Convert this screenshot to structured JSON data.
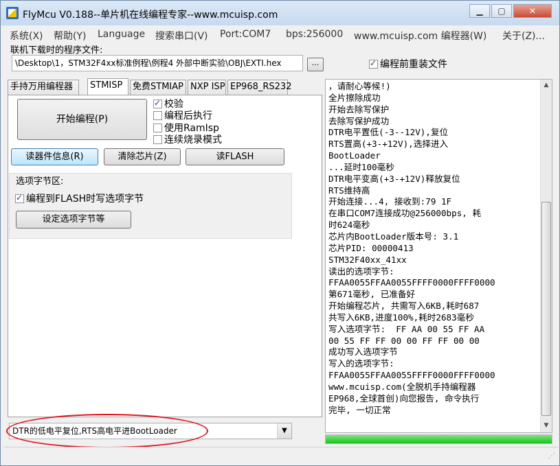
{
  "titlebar": {
    "title": "FlyMcu V0.188--单片机在线编程专家--www.mcuisp.com"
  },
  "menubar": {
    "items": [
      "系统(X)",
      "帮助(Y)",
      "Language",
      "搜索串口(V)",
      "Port:COM7",
      "bps:256000",
      "www.mcuisp.com 编程器(W)",
      "关于(Z)..."
    ]
  },
  "file": {
    "label": "联机下载时的程序文件:",
    "path": "\\Desktop\\1，STM32F4xx标准例程\\例程4 外部中断实验\\OBJ\\EXTI.hex",
    "browse_label": "...",
    "reload_label": "编程前重装文件",
    "reload_checked": true
  },
  "tabs": [
    "手持万用编程器",
    "STMISP",
    "免费STMIAP",
    "NXP ISP",
    "EP968_RS232"
  ],
  "active_tab": "STMISP",
  "stmisp": {
    "start_label": "开始编程(P)",
    "options": [
      {
        "label": "校验",
        "checked": true
      },
      {
        "label": "编程后执行",
        "checked": false
      },
      {
        "label": "使用RamIsp",
        "checked": false
      },
      {
        "label": "连续烧录模式",
        "checked": false
      }
    ],
    "read_info_label": "读器件信息(R)",
    "erase_label": "清除芯片(Z)",
    "read_flash_label": "读FLASH",
    "option_group_title": "选项字节区:",
    "write_option_label": "编程到FLASH时写选项字节",
    "write_option_checked": true,
    "set_option_label": "设定选项字节等"
  },
  "reset_mode": "DTR的低电平复位,RTS高电平进BootLoader",
  "log_lines": [
    "，请耐心等候!)",
    "全片擦除成功",
    "开始去除写保护",
    "去除写保护成功",
    "DTR电平置低(-3--12V),复位",
    "RTS置高(+3-+12V),选择进入",
    "BootLoader",
    "...延时100毫秒",
    "DTR电平变高(+3-+12V)释放复位",
    "RTS维持高",
    "开始连接...4, 接收到:79 1F",
    "在串口COM7连接成功@256000bps, 耗",
    "时624毫秒",
    "芯片内BootLoader版本号: 3.1",
    "芯片PID: 00000413",
    "STM32F40xx_41xx",
    "读出的选项字节:",
    "FFAA0055FFAA0055FFFF0000FFFF0000",
    "第671毫秒, 已准备好",
    "开始编程芯片, 共需写入6KB,耗时687",
    "共写入6KB,进度100%,耗时2683毫秒",
    "写入选项字节:  FF AA 00 55 FF AA",
    "00 55 FF FF 00 00 FF FF 00 00",
    "成功写入选项字节",
    "写入的选项字节:",
    "FFAA0055FFAA0055FFFF0000FFFF0000",
    "www.mcuisp.com(全脱机手持编程器",
    "EP968,全球首创)向您报告, 命令执行",
    "完毕, 一切正常"
  ],
  "progress": 1.0,
  "colors": {
    "progress": "#16c41b",
    "annotation": "#e0131b"
  }
}
